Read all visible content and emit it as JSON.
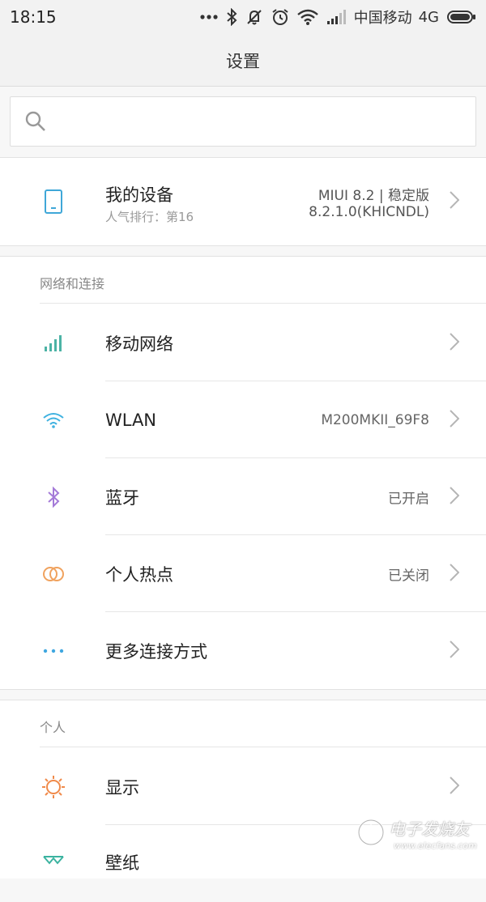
{
  "status_bar": {
    "time": "18:15",
    "carrier": "中国移动",
    "network": "4G",
    "icons": [
      "more-dots-icon",
      "bluetooth-icon",
      "mute-icon",
      "alarm-icon",
      "wifi-icon",
      "signal-icon",
      "battery-icon"
    ]
  },
  "header": {
    "title": "设置"
  },
  "search": {
    "placeholder": ""
  },
  "device": {
    "title": "我的设备",
    "subtitle": "人气排行：第16",
    "version_line1": "MIUI 8.2 | 稳定版",
    "version_line2": "8.2.1.0(KHICNDL)",
    "icon": "phone-icon"
  },
  "section_network": {
    "header": "网络和连接",
    "items": [
      {
        "label": "移动网络",
        "value": "",
        "icon": "signal-bars-icon",
        "color": "#4cb3a5"
      },
      {
        "label": "WLAN",
        "value": "M200MKII_69F8",
        "icon": "wifi-icon",
        "color": "#3fb2e0"
      },
      {
        "label": "蓝牙",
        "value": "已开启",
        "icon": "bluetooth-icon",
        "color": "#a47ad8"
      },
      {
        "label": "个人热点",
        "value": "已关闭",
        "icon": "hotspot-icon",
        "color": "#f0a25e"
      },
      {
        "label": "更多连接方式",
        "value": "",
        "icon": "more-dots-icon",
        "color": "#3fa7e0"
      }
    ]
  },
  "section_personal": {
    "header": "个人",
    "items": [
      {
        "label": "显示",
        "value": "",
        "icon": "sun-icon",
        "color": "#f08a4a"
      },
      {
        "label": "壁纸",
        "value": "",
        "icon": "wallpaper-icon",
        "color": "#3bb3a0"
      }
    ]
  },
  "watermark": {
    "text": "电子发烧友",
    "url": "www.elecfans.com"
  }
}
